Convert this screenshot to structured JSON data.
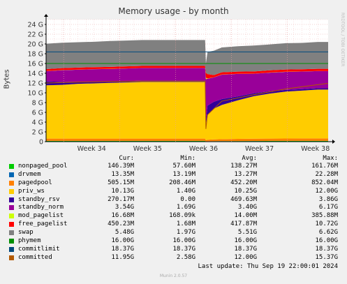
{
  "chart_data": {
    "type": "area",
    "title": "Memory usage - by month",
    "ylabel": "Bytes",
    "side_label": "RRDTOOL / TOBI OETIKER",
    "ylim": [
      0,
      25
    ],
    "yticks": [
      "0",
      "2 G",
      "4 G",
      "6 G",
      "8 G",
      "10 G",
      "12 G",
      "14 G",
      "16 G",
      "18 G",
      "20 G",
      "22 G",
      "24 G"
    ],
    "xticks": [
      "Week 34",
      "Week 35",
      "Week 36",
      "Week 37",
      "Week 38"
    ],
    "grid": true,
    "x_days": [
      0,
      2,
      4,
      6,
      8,
      10,
      12,
      14,
      16,
      18,
      19.9,
      20,
      20.2,
      21,
      22,
      24,
      26,
      28,
      30,
      32,
      34,
      35.3
    ],
    "series": [
      {
        "name": "nonpaged_pool",
        "color": "#00cc00",
        "values": [
          0.14,
          0.14,
          0.14,
          0.14,
          0.14,
          0.14,
          0.14,
          0.14,
          0.14,
          0.14,
          0.14,
          0.06,
          0.08,
          0.1,
          0.11,
          0.12,
          0.13,
          0.14,
          0.14,
          0.14,
          0.15,
          0.15
        ]
      },
      {
        "name": "drvmem",
        "color": "#0066b3",
        "values": [
          0.013,
          0.013,
          0.013,
          0.013,
          0.013,
          0.013,
          0.013,
          0.013,
          0.013,
          0.013,
          0.013,
          0.013,
          0.013,
          0.013,
          0.013,
          0.013,
          0.013,
          0.013,
          0.013,
          0.013,
          0.013,
          0.013
        ]
      },
      {
        "name": "pagedpool",
        "color": "#ff8000",
        "values": [
          0.48,
          0.48,
          0.48,
          0.48,
          0.48,
          0.48,
          0.48,
          0.48,
          0.48,
          0.48,
          0.48,
          0.21,
          0.3,
          0.35,
          0.4,
          0.44,
          0.46,
          0.48,
          0.49,
          0.5,
          0.5,
          0.5
        ]
      },
      {
        "name": "priv_ws",
        "color": "#ffcc00",
        "values": [
          10.9,
          11.0,
          11.2,
          11.3,
          11.4,
          11.5,
          11.6,
          11.6,
          11.6,
          11.6,
          11.6,
          3.5,
          5.0,
          6.3,
          7.0,
          7.9,
          8.7,
          9.2,
          9.6,
          9.8,
          10.0,
          10.0
        ]
      },
      {
        "name": "standby_rsv",
        "color": "#330099",
        "values": [
          0.8,
          0.6,
          0.4,
          0.3,
          0.25,
          0.25,
          0.25,
          0.25,
          0.25,
          0.25,
          0.25,
          0.5,
          2.0,
          1.4,
          1.2,
          0.8,
          0.6,
          0.5,
          0.35,
          0.3,
          0.28,
          0.27
        ]
      },
      {
        "name": "standby_norm",
        "color": "#990099",
        "values": [
          2.1,
          2.4,
          2.5,
          2.6,
          2.6,
          2.6,
          2.6,
          2.6,
          2.6,
          2.6,
          2.6,
          8.5,
          5.5,
          5.0,
          5.0,
          4.6,
          4.0,
          3.8,
          3.7,
          3.6,
          3.5,
          3.5
        ]
      },
      {
        "name": "mod_pagelist",
        "color": "#ccff00",
        "values": [
          0.02,
          0.02,
          0.02,
          0.02,
          0.02,
          0.02,
          0.02,
          0.02,
          0.02,
          0.02,
          0.02,
          0.3,
          0.05,
          0.02,
          0.02,
          0.02,
          0.02,
          0.02,
          0.02,
          0.02,
          0.02,
          0.02
        ]
      },
      {
        "name": "free_pagelist",
        "color": "#ff0000",
        "values": [
          0.4,
          0.4,
          0.4,
          0.4,
          0.4,
          0.4,
          0.4,
          0.4,
          0.4,
          0.4,
          0.4,
          1.0,
          0.9,
          0.45,
          0.45,
          0.45,
          0.45,
          0.45,
          0.45,
          0.45,
          0.45,
          0.45
        ]
      },
      {
        "name": "swap",
        "color": "#808080",
        "values": [
          5.2,
          5.2,
          5.2,
          5.2,
          5.3,
          5.3,
          5.3,
          5.3,
          5.3,
          5.3,
          5.3,
          1.9,
          4.5,
          5.0,
          5.1,
          5.2,
          5.3,
          5.3,
          5.4,
          5.4,
          5.5,
          5.5
        ]
      }
    ],
    "lines": [
      {
        "name": "phymem",
        "color": "#008f00",
        "values": [
          16.0,
          16.0
        ]
      },
      {
        "name": "commitlimit",
        "color": "#00487d",
        "values": [
          18.37,
          18.37
        ]
      },
      {
        "name": "committed",
        "color": "#b35a00",
        "x_days": [
          0,
          4,
          8,
          12,
          16,
          19.9,
          20,
          20.2,
          22,
          26,
          30,
          35.3
        ],
        "values": [
          12.0,
          12.2,
          12.3,
          12.4,
          12.4,
          12.4,
          2.6,
          5.5,
          8.3,
          9.6,
          10.8,
          11.95
        ]
      }
    ]
  },
  "legend": {
    "headers": {
      "cur": "Cur:",
      "min": "Min:",
      "avg": "Avg:",
      "max": "Max:"
    },
    "rows": [
      {
        "name": "nonpaged_pool",
        "color": "#00cc00",
        "cur": "146.39M",
        "min": "57.60M",
        "avg": "138.27M",
        "max": "161.76M"
      },
      {
        "name": "drvmem",
        "color": "#0066b3",
        "cur": "13.35M",
        "min": "13.19M",
        "avg": "13.27M",
        "max": "22.28M"
      },
      {
        "name": "pagedpool",
        "color": "#ff8000",
        "cur": "505.15M",
        "min": "208.46M",
        "avg": "452.20M",
        "max": "852.04M"
      },
      {
        "name": "priv_ws",
        "color": "#ffcc00",
        "cur": "10.13G",
        "min": "1.40G",
        "avg": "10.25G",
        "max": "12.00G"
      },
      {
        "name": "standby_rsv",
        "color": "#330099",
        "cur": "270.17M",
        "min": "0.00",
        "avg": "469.63M",
        "max": "3.86G"
      },
      {
        "name": "standby_norm",
        "color": "#990099",
        "cur": "3.54G",
        "min": "1.69G",
        "avg": "3.40G",
        "max": "6.17G"
      },
      {
        "name": "mod_pagelist",
        "color": "#ccff00",
        "cur": "16.68M",
        "min": "168.09k",
        "avg": "14.00M",
        "max": "385.88M"
      },
      {
        "name": "free_pagelist",
        "color": "#ff0000",
        "cur": "450.23M",
        "min": "1.68M",
        "avg": "417.87M",
        "max": "10.72G"
      },
      {
        "name": "swap",
        "color": "#808080",
        "cur": "5.48G",
        "min": "1.97G",
        "avg": "5.51G",
        "max": "6.62G"
      },
      {
        "name": "phymem",
        "color": "#008f00",
        "cur": "16.00G",
        "min": "16.00G",
        "avg": "16.00G",
        "max": "16.00G"
      },
      {
        "name": "commitlimit",
        "color": "#00487d",
        "cur": "18.37G",
        "min": "18.37G",
        "avg": "18.37G",
        "max": "18.37G"
      },
      {
        "name": "committed",
        "color": "#b35a00",
        "cur": "11.95G",
        "min": "2.58G",
        "avg": "12.00G",
        "max": "15.37G"
      }
    ]
  },
  "footer": {
    "last_update": "Last update: Thu Sep 19 22:00:01 2024",
    "generator": "Munin 2.0.57"
  }
}
